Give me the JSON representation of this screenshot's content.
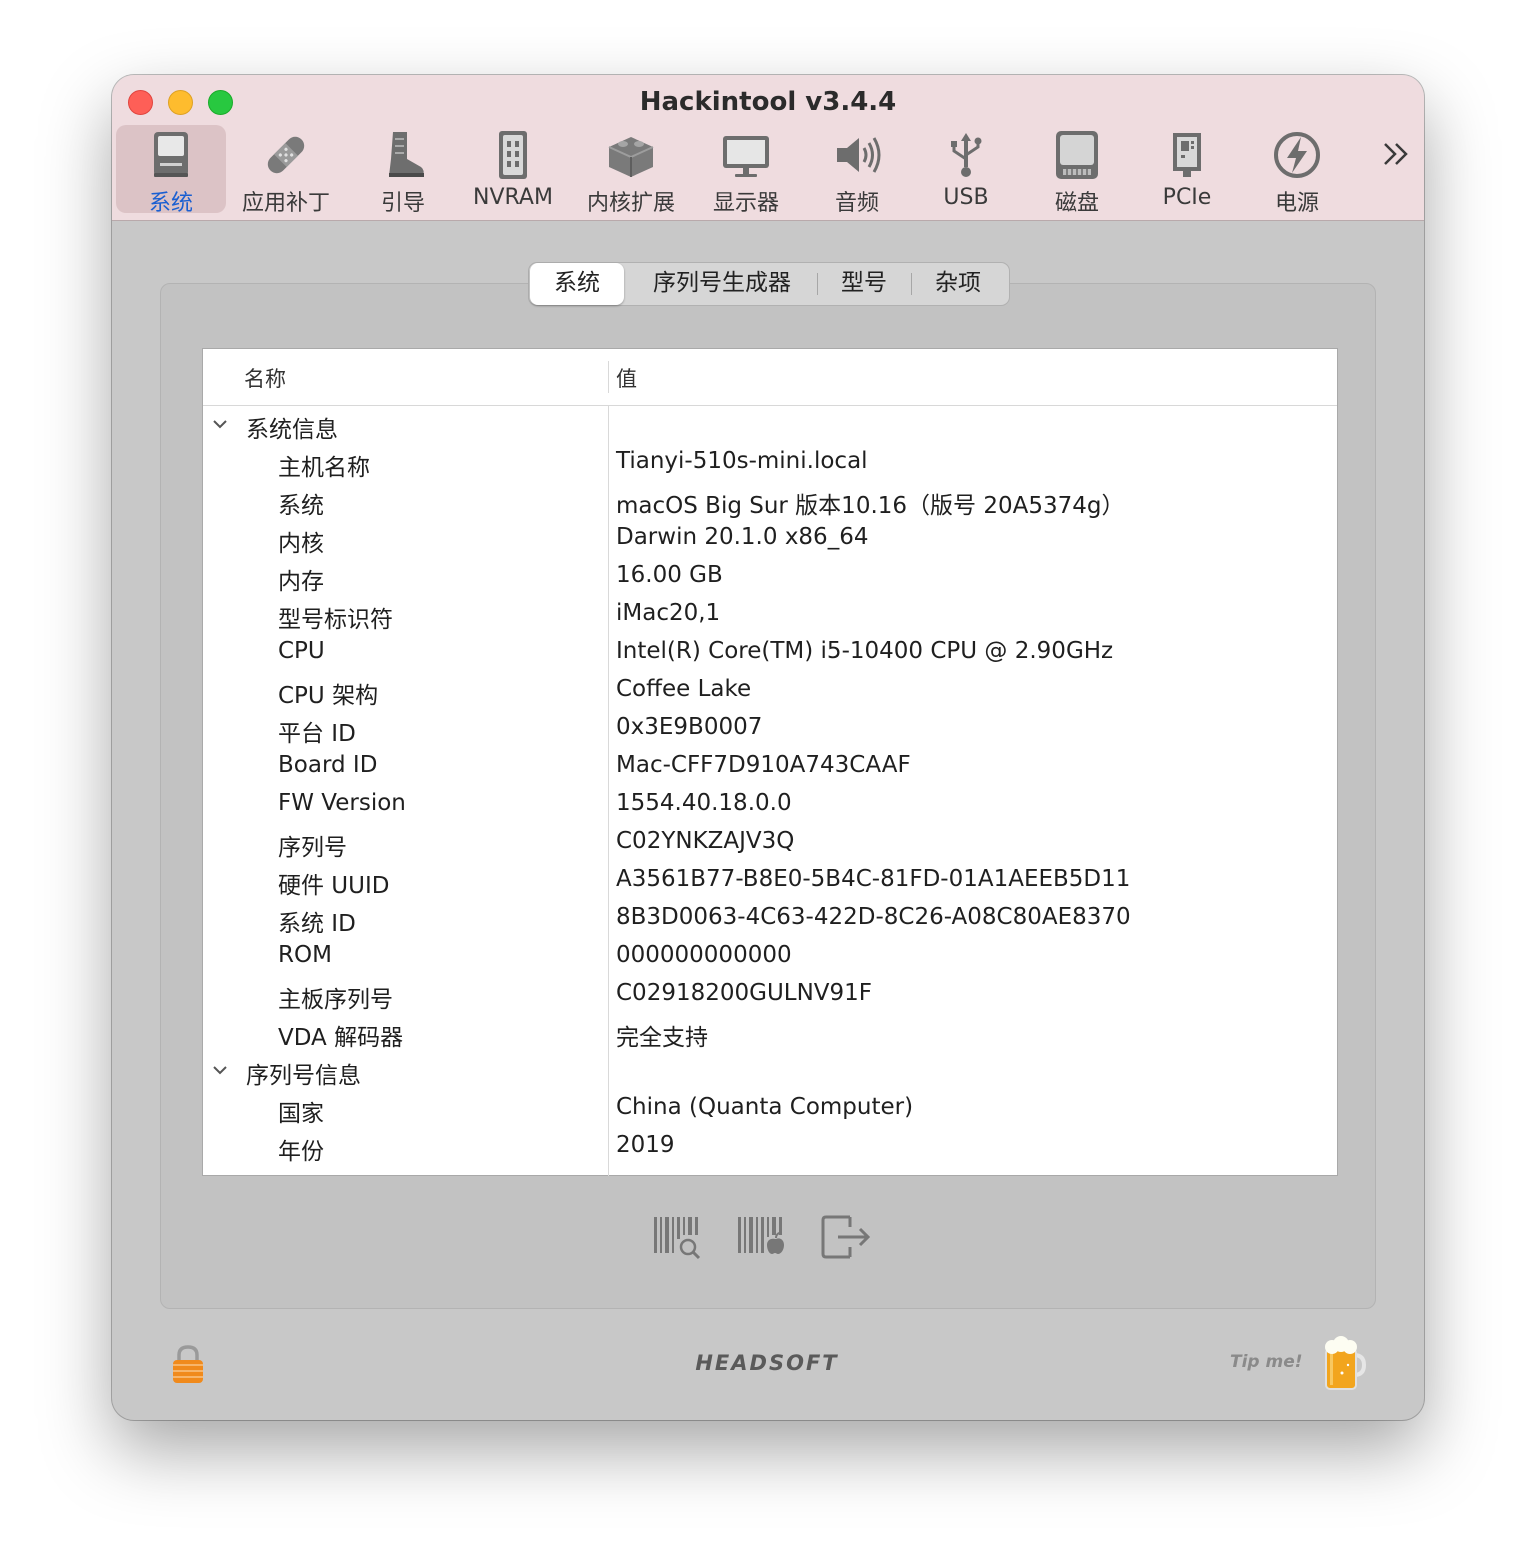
{
  "window": {
    "title": "Hackintool v3.4.4"
  },
  "toolbar": {
    "items": [
      {
        "label": "系统",
        "icon": "computer-icon"
      },
      {
        "label": "应用补丁",
        "icon": "bandage-icon"
      },
      {
        "label": "引导",
        "icon": "boot-icon"
      },
      {
        "label": "NVRAM",
        "icon": "memory-chip-icon"
      },
      {
        "label": "内核扩展",
        "icon": "kext-lego-icon"
      },
      {
        "label": "显示器",
        "icon": "display-icon"
      },
      {
        "label": "音频",
        "icon": "speaker-icon"
      },
      {
        "label": "USB",
        "icon": "usb-icon"
      },
      {
        "label": "磁盘",
        "icon": "disk-icon"
      },
      {
        "label": "PCIe",
        "icon": "pcie-card-icon"
      },
      {
        "label": "电源",
        "icon": "power-bolt-icon"
      }
    ],
    "active_index": 0,
    "overflow_icon": "chevron-double-right-icon"
  },
  "tabs": {
    "items": [
      {
        "label": "系统"
      },
      {
        "label": "序列号生成器"
      },
      {
        "label": "型号"
      },
      {
        "label": "杂项"
      }
    ],
    "active_index": 0
  },
  "table": {
    "columns": {
      "name": "名称",
      "value": "值"
    },
    "groups": [
      {
        "title": "系统信息",
        "rows": [
          {
            "name": "主机名称",
            "value": "Tianyi-510s-mini.local"
          },
          {
            "name": "系统",
            "value": "macOS Big Sur 版本10.16（版号 20A5374g）"
          },
          {
            "name": "内核",
            "value": "Darwin 20.1.0 x86_64"
          },
          {
            "name": "内存",
            "value": "16.00 GB"
          },
          {
            "name": "型号标识符",
            "value": "iMac20,1"
          },
          {
            "name": "CPU",
            "value": "Intel(R) Core(TM) i5-10400 CPU @ 2.90GHz"
          },
          {
            "name": "CPU 架构",
            "value": "Coffee Lake"
          },
          {
            "name": "平台 ID",
            "value": "0x3E9B0007"
          },
          {
            "name": "Board ID",
            "value": "Mac-CFF7D910A743CAAF"
          },
          {
            "name": "FW Version",
            "value": "1554.40.18.0.0"
          },
          {
            "name": "序列号",
            "value": "C02YNKZAJV3Q"
          },
          {
            "name": "硬件 UUID",
            "value": "A3561B77-B8E0-5B4C-81FD-01A1AEEB5D11"
          },
          {
            "name": "系统 ID",
            "value": "8B3D0063-4C63-422D-8C26-A08C80AE8370"
          },
          {
            "name": "ROM",
            "value": "000000000000"
          },
          {
            "name": "主板序列号",
            "value": "C02918200GULNV91F"
          },
          {
            "name": "VDA 解码器",
            "value": "完全支持"
          }
        ]
      },
      {
        "title": "序列号信息",
        "rows": [
          {
            "name": "国家",
            "value": "China (Quanta Computer)"
          },
          {
            "name": "年份",
            "value": "2019"
          }
        ]
      }
    ]
  },
  "bottom_actions": [
    {
      "icon": "barcode-search-icon"
    },
    {
      "icon": "barcode-apple-icon"
    },
    {
      "icon": "export-icon"
    }
  ],
  "footer": {
    "lock_icon": "lock-icon",
    "brand": "HEADSOFT",
    "tip_label": "Tip me!",
    "beer_icon": "beer-mug-icon"
  },
  "colors": {
    "titlebar": "#efdcdf",
    "accent": "#1a5fd1",
    "close": "#fe5f57",
    "minimize": "#febc2e",
    "maximize": "#28c840"
  }
}
